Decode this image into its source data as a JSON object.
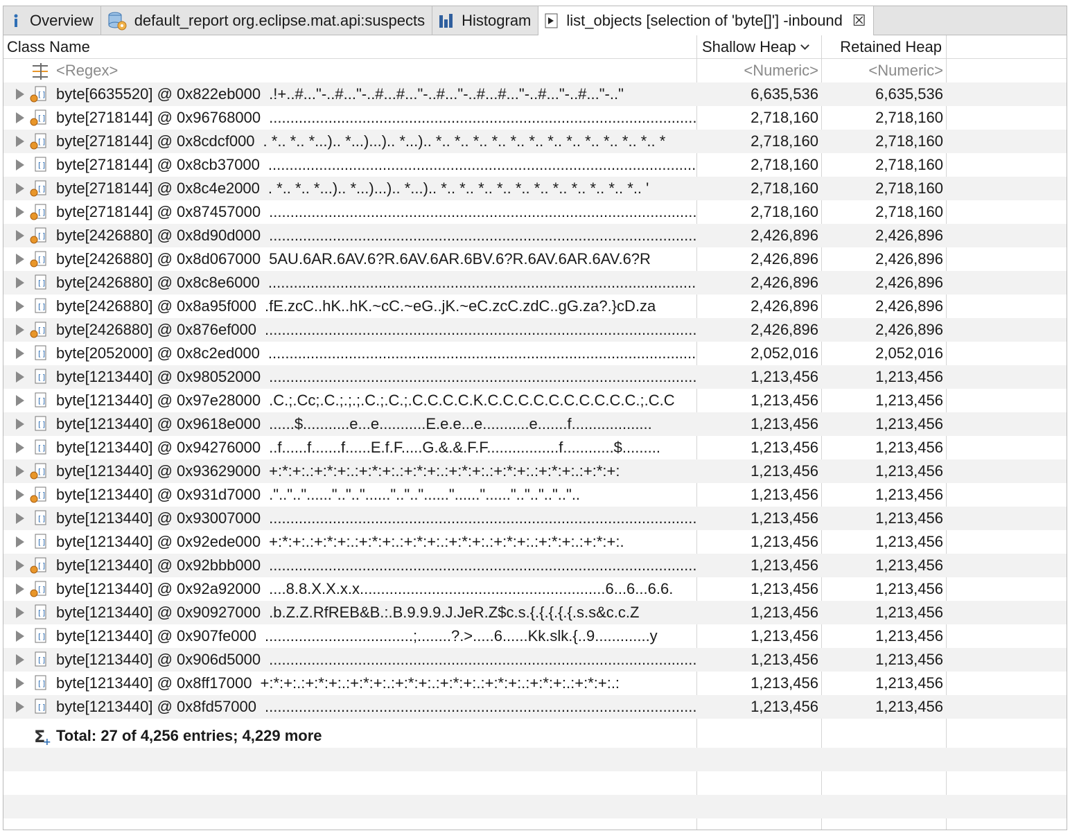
{
  "tabs": [
    {
      "label": "Overview",
      "icon": "info-icon"
    },
    {
      "label": "default_report  org.eclipse.mat.api:suspects",
      "icon": "report-database-icon"
    },
    {
      "label": "Histogram",
      "icon": "histogram-icon"
    },
    {
      "label": "list_objects [selection of 'byte[]'] -inbound",
      "icon": "list-objects-icon",
      "close": "☒"
    }
  ],
  "columns": {
    "class_name": "Class Name",
    "shallow_heap": "Shallow Heap",
    "retained_heap": "Retained Heap"
  },
  "filter_row": {
    "name": "<Regex>",
    "shallow": "<Numeric>",
    "retained": "<Numeric>"
  },
  "rows": [
    {
      "name": "byte[6635520] @ 0x822eb000",
      "preview": ".!+..#...\"-..#...\"-..#...#...\"-..#...\"-..#...#...\"-..#...\"-..#...\"-..\"",
      "shallow": "6,635,536",
      "retained": "6,635,536",
      "gc": true
    },
    {
      "name": "byte[2718144] @ 0x96768000",
      "preview": "..........................................................................................................",
      "shallow": "2,718,160",
      "retained": "2,718,160",
      "gc": true
    },
    {
      "name": "byte[2718144] @ 0x8cdcf000",
      "preview": ". *.. *.. *...).. *...)...).. *...).. *.. *.. *.. *.. *.. *.. *.. *.. *.. *.. *.. *.. *",
      "shallow": "2,718,160",
      "retained": "2,718,160",
      "gc": true
    },
    {
      "name": "byte[2718144] @ 0x8cb37000",
      "preview": "..........................................................................................................",
      "shallow": "2,718,160",
      "retained": "2,718,160",
      "gc": false
    },
    {
      "name": "byte[2718144] @ 0x8c4e2000",
      "preview": ". *.. *.. *...).. *...)...).. *...).. *.. *.. *.. *.. *.. *.. *.. *.. *.. *.. *.. '",
      "shallow": "2,718,160",
      "retained": "2,718,160",
      "gc": true
    },
    {
      "name": "byte[2718144] @ 0x87457000",
      "preview": "..........................................................................................................",
      "shallow": "2,718,160",
      "retained": "2,718,160",
      "gc": true
    },
    {
      "name": "byte[2426880] @ 0x8d90d000",
      "preview": "..........................................................................................................",
      "shallow": "2,426,896",
      "retained": "2,426,896",
      "gc": true
    },
    {
      "name": "byte[2426880] @ 0x8d067000",
      "preview": "5AU.6AR.6AV.6?R.6AV.6AR.6BV.6?R.6AV.6AR.6AV.6?R",
      "shallow": "2,426,896",
      "retained": "2,426,896",
      "gc": true
    },
    {
      "name": "byte[2426880] @ 0x8c8e6000",
      "preview": "..........................................................................................................",
      "shallow": "2,426,896",
      "retained": "2,426,896",
      "gc": false
    },
    {
      "name": "byte[2426880] @ 0x8a95f000",
      "preview": ".fE.zcC..hK..hK.~cC.~eG..jK.~eC.zcC.zdC..gG.za?.}cD.za",
      "shallow": "2,426,896",
      "retained": "2,426,896",
      "gc": false
    },
    {
      "name": "byte[2426880] @ 0x876ef000",
      "preview": "..........................................................................................................",
      "shallow": "2,426,896",
      "retained": "2,426,896",
      "gc": true
    },
    {
      "name": "byte[2052000] @ 0x8c2ed000",
      "preview": "..........................................................................................................",
      "shallow": "2,052,016",
      "retained": "2,052,016",
      "gc": false
    },
    {
      "name": "byte[1213440] @ 0x98052000",
      "preview": "..........................................................................................................",
      "shallow": "1,213,456",
      "retained": "1,213,456",
      "gc": false
    },
    {
      "name": "byte[1213440] @ 0x97e28000",
      "preview": ".C.;.Cc;.C.;.;.;.C.;.C.;.C.C.C.C.K.C.C.C.C.C.C.C.C.C.C.;.C.C",
      "shallow": "1,213,456",
      "retained": "1,213,456",
      "gc": false
    },
    {
      "name": "byte[1213440] @ 0x9618e000",
      "preview": "......$...........e...e...........E.e.e...e...........e.......f...................",
      "shallow": "1,213,456",
      "retained": "1,213,456",
      "gc": false
    },
    {
      "name": "byte[1213440] @ 0x94276000",
      "preview": "..f......f.......f......E.f.F.....G.&.&.F.F.................f............$.........",
      "shallow": "1,213,456",
      "retained": "1,213,456",
      "gc": false
    },
    {
      "name": "byte[1213440] @ 0x93629000",
      "preview": "+:*:+:.:+:*:+:.:+:*:+:.:+:*:+:.:+:*:+:.:+:*:+:.:+:*:+:.:+:*:+:",
      "shallow": "1,213,456",
      "retained": "1,213,456",
      "gc": true
    },
    {
      "name": "byte[1213440] @ 0x931d7000",
      "preview": ".\"..\"..\"......\"..\"..\"......\"..\"..\"......\"......\"......\"..\"..\"..\"..\"..",
      "shallow": "1,213,456",
      "retained": "1,213,456",
      "gc": true
    },
    {
      "name": "byte[1213440] @ 0x93007000",
      "preview": "..........................................................................................................",
      "shallow": "1,213,456",
      "retained": "1,213,456",
      "gc": false
    },
    {
      "name": "byte[1213440] @ 0x92ede000",
      "preview": "+:*:+:.:+:*:+:.:+:*:+:.:+:*:+:.:+:*:+:.:+:*:+:.:+:*:+:.:+:*:+:.",
      "shallow": "1,213,456",
      "retained": "1,213,456",
      "gc": false
    },
    {
      "name": "byte[1213440] @ 0x92bbb000",
      "preview": "..........................................................................................................",
      "shallow": "1,213,456",
      "retained": "1,213,456",
      "gc": true
    },
    {
      "name": "byte[1213440] @ 0x92a92000",
      "preview": "....8.8.X.X.x.x..........................................................6...6...6.6.",
      "shallow": "1,213,456",
      "retained": "1,213,456",
      "gc": true
    },
    {
      "name": "byte[1213440] @ 0x90927000",
      "preview": ".b.Z.Z.RfREB&B.:.B.9.9.9.J.JeR.Z$c.s.{.{.{.{.{.s.s&c.c.Z",
      "shallow": "1,213,456",
      "retained": "1,213,456",
      "gc": false
    },
    {
      "name": "byte[1213440] @ 0x907fe000",
      "preview": "...................................;........?.>.....6......Kk.slk.{..9.............y",
      "shallow": "1,213,456",
      "retained": "1,213,456",
      "gc": false
    },
    {
      "name": "byte[1213440] @ 0x906d5000",
      "preview": "..........................................................................................................",
      "shallow": "1,213,456",
      "retained": "1,213,456",
      "gc": false
    },
    {
      "name": "byte[1213440] @ 0x8ff17000",
      "preview": "+:*:+:.:+:*:+:.:+:*:+:.:+:*:+:.:+:*:+:.:+:*:+:.:+:*:+:.:+:*:+:.:",
      "shallow": "1,213,456",
      "retained": "1,213,456",
      "gc": false
    },
    {
      "name": "byte[1213440] @ 0x8fd57000",
      "preview": "..........................................................................................................",
      "shallow": "1,213,456",
      "retained": "1,213,456",
      "gc": false
    }
  ],
  "total_row": "Total: 27 of 4,256 entries; 4,229 more",
  "colors": {
    "tabbar_bg": "#e4e4e4",
    "row_alt": "#f2f2f2",
    "icon_blue": "#2f6fb5",
    "gc_root_orange": "#e8962a"
  }
}
